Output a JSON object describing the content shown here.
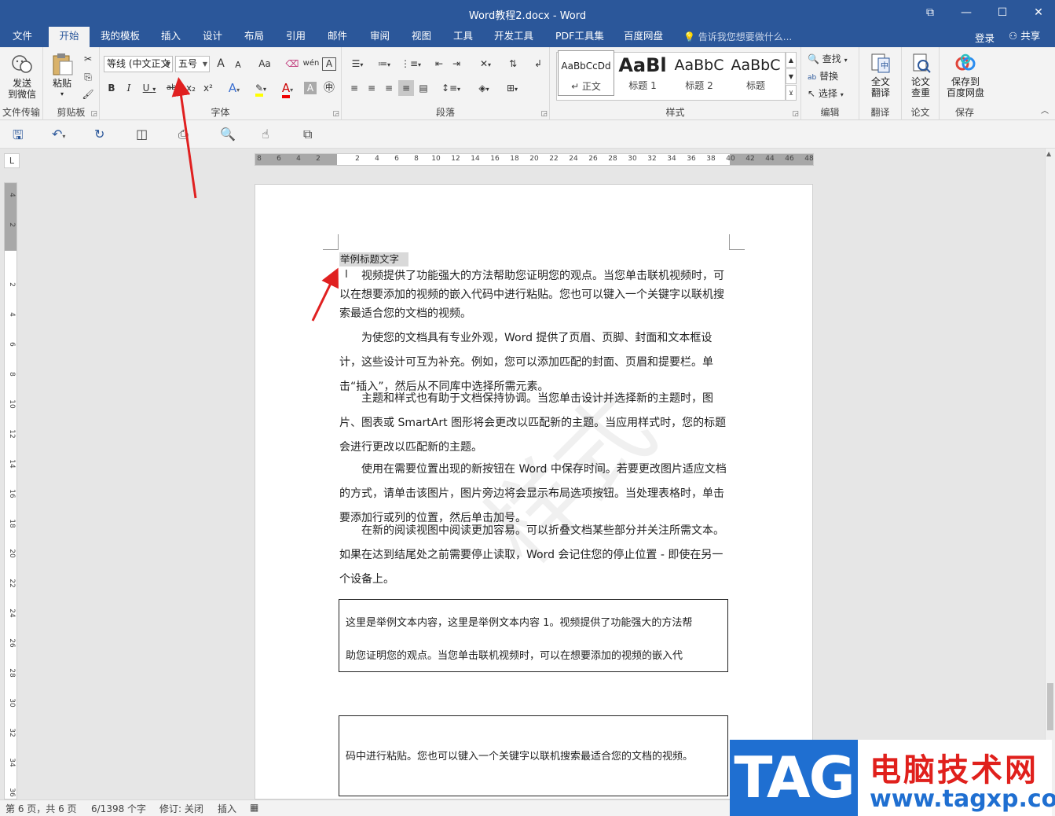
{
  "window": {
    "title": "Word教程2.docx - Word",
    "buttons": [
      "⧉",
      "—",
      "☐",
      "✕"
    ]
  },
  "tabs": [
    "文件",
    "开始",
    "我的模板",
    "插入",
    "设计",
    "布局",
    "引用",
    "邮件",
    "审阅",
    "视图",
    "工具",
    "开发工具",
    "PDF工具集",
    "百度网盘"
  ],
  "active_tab": "开始",
  "tellme_placeholder": "告诉我您想要做什么...",
  "login": "登录",
  "share": "共享",
  "ribbon": {
    "wechat": {
      "label1": "发送",
      "label2": "到微信",
      "group": "文件传输"
    },
    "clipboard": {
      "paste": "粘贴",
      "group": "剪贴板"
    },
    "font": {
      "name": "等线 (中文正文",
      "size": "五号",
      "group": "字体",
      "bold": "B",
      "italic": "I",
      "underline": "U",
      "strike": "abc",
      "sub": "x₂",
      "sup": "x²",
      "grow": "A",
      "shrink": "A",
      "case": "Aa",
      "phonetic": "wén",
      "border_char": "A"
    },
    "paragraph": {
      "group": "段落"
    },
    "styles": {
      "group": "样式",
      "items": [
        {
          "preview": "AaBbCcDd",
          "name": "↵ 正文"
        },
        {
          "preview": "AaBl",
          "name": "标题 1"
        },
        {
          "preview": "AaBbC",
          "name": "标题 2"
        },
        {
          "preview": "AaBbC",
          "name": "标题"
        }
      ]
    },
    "editing": {
      "find": "查找",
      "replace": "替换",
      "select": "选择",
      "group": "编辑"
    },
    "translate": {
      "label1": "全文",
      "label2": "翻译",
      "group": "翻译"
    },
    "paper": {
      "label1": "论文",
      "label2": "查重",
      "group": "论文"
    },
    "save": {
      "label1": "保存到",
      "label2": "百度网盘",
      "group": "保存"
    }
  },
  "ruler": {
    "h_numbers": [
      "8",
      "6",
      "4",
      "2",
      "",
      "2",
      "4",
      "6",
      "8",
      "10",
      "12",
      "14",
      "16",
      "18",
      "20",
      "22",
      "24",
      "26",
      "28",
      "30",
      "32",
      "34",
      "36",
      "38",
      "40",
      "42",
      "44",
      "46",
      "48"
    ],
    "v_numbers": [
      "4",
      "2",
      "",
      "2",
      "4",
      "6",
      "8",
      "10",
      "12",
      "14",
      "16",
      "18",
      "20",
      "22",
      "24",
      "26",
      "28",
      "30",
      "32",
      "34",
      "36"
    ],
    "corner": "L"
  },
  "document": {
    "heading": "举例标题文字",
    "paragraphs": [
      "视频提供了功能强大的方法帮助您证明您的观点。当您单击联机视频时，可以在想要添加的视频的嵌入代码中进行粘贴。您也可以键入一个关键字以联机搜索最适合您的文档的视频。",
      "为使您的文档具有专业外观，Word 提供了页眉、页脚、封面和文本框设计，这些设计可互为补充。例如，您可以添加匹配的封面、页眉和提要栏。单击“插入”，然后从不同库中选择所需元素。",
      "主题和样式也有助于文档保持协调。当您单击设计并选择新的主题时，图片、图表或 SmartArt 图形将会更改以匹配新的主题。当应用样式时，您的标题会进行更改以匹配新的主题。",
      "使用在需要位置出现的新按钮在 Word 中保存时间。若要更改图片适应文档的方式，请单击该图片，图片旁边将会显示布局选项按钮。当处理表格时，单击要添加行或列的位置，然后单击加号。",
      "在新的阅读视图中阅读更加容易。可以折叠文档某些部分并关注所需文本。如果在达到结尾处之前需要停止读取，Word 会记住您的停止位置 - 即使在另一个设备上。"
    ],
    "textbox1_line1": "这里是举例文本内容，这里是举例文本内容 1。视频提供了功能强大的方法帮",
    "textbox1_line2": "助您证明您的观点。当您单击联机视频时，可以在想要添加的视频的嵌入代",
    "textbox2": "码中进行粘贴。您也可以键入一个关键字以联机搜索最适合您的文档的视频。"
  },
  "status": {
    "page": "第 6 页，共 6 页",
    "words": "6/1398 个字",
    "revision": "修订: 关闭",
    "mode": "插入"
  },
  "watermark": {
    "tag": "TAG",
    "cn": "电脑技术网",
    "url": "www.tagxp.com"
  },
  "colors": {
    "accent": "#2b579a",
    "arrow": "#e02020"
  }
}
